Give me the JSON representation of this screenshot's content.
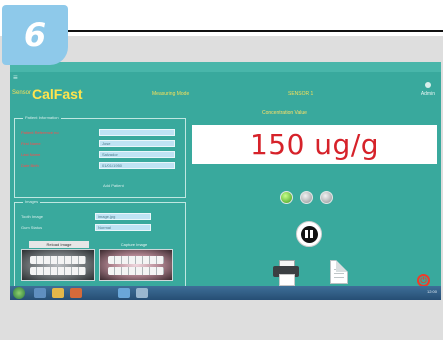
{
  "step_badge": "6",
  "app": {
    "brand_prefix": "Sensor",
    "brand": "CalFast",
    "header_mid": "Measuring Mode",
    "header_right": "SENSOR 1",
    "header_user": "Admin",
    "concentration_label": "Concentration Value",
    "menu_icon": "≡"
  },
  "patient_panel": {
    "title": "Patient Information",
    "fields": [
      {
        "label": "Patient Reference no",
        "value": ""
      },
      {
        "label": "First Name",
        "value": "Jose"
      },
      {
        "label": "Last Name",
        "value": "Salvador"
      },
      {
        "label": "Date Birth",
        "value": "01/01/1950"
      }
    ],
    "note": "Add Patient"
  },
  "image_panel": {
    "title": "Images",
    "fields": [
      {
        "label": "Tooth Image",
        "value": "image.jpg"
      },
      {
        "label": "Gum Status",
        "value": "Normal"
      }
    ],
    "load_button": "Reload Image",
    "capture_button": "Capture Image"
  },
  "reading": {
    "value": "150 ug/g"
  },
  "status_colors": {
    "active": "#3f9d1c",
    "inactive": "#8e9496"
  },
  "icons": [
    "menu-icon",
    "user-icon",
    "printer-icon",
    "document-icon",
    "power-icon",
    "pause-icon",
    "start-icon"
  ],
  "taskbar": {
    "tray_text": "12:00"
  }
}
